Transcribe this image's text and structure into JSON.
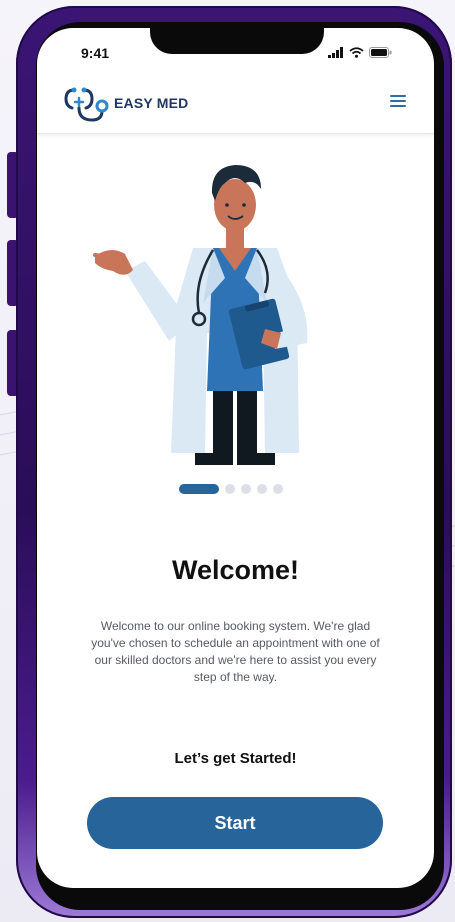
{
  "status_bar": {
    "time": "9:41"
  },
  "header": {
    "brand": "EASY MED",
    "brand_color": "#1e3763",
    "menu_icon": "hamburger-menu-icon"
  },
  "carousel": {
    "total_pages": 5,
    "current_page": 1,
    "active_color": "#27649a"
  },
  "content": {
    "title": "Welcome!",
    "description": "Welcome to our online booking system. We're glad you've chosen to schedule an appointment with one of our skilled doctors and we're here to assist you every step of the way.",
    "subtitle": "Let’s get Started!"
  },
  "actions": {
    "start_label": "Start"
  },
  "colors": {
    "accent": "#27649a",
    "frame": "#3b1575"
  }
}
